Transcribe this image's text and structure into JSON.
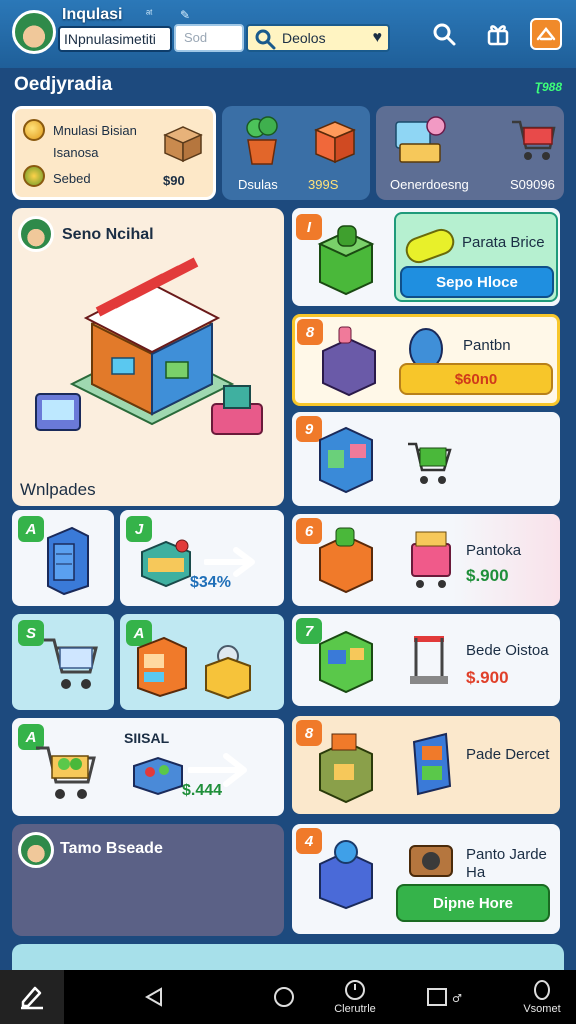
{
  "header": {
    "player_name": "Inqulasi",
    "player_stat": "ᵃᵗ",
    "player_stat_icon": "✎",
    "dropdown_value": "INpnulasimetiti",
    "search_placeholder": "Sod",
    "search_query": "Deolos"
  },
  "section": {
    "title": "Oedjyradia",
    "badge": "Ʈ988"
  },
  "top_cards": [
    {
      "line1": "Mnulasi Bisian",
      "line2": "Isanosa",
      "line3": "Sebed",
      "price": "$90"
    },
    {
      "label": "Dsulas",
      "value": "399S"
    },
    {
      "label": "Oenerdoesng",
      "value": "S09096"
    }
  ],
  "store_card": {
    "title": "Seno Ncihal",
    "subtitle": "Wnlpades"
  },
  "left_items": [
    {
      "badge": "A",
      "tag": ""
    },
    {
      "badge": "J",
      "tag": "$34%"
    },
    {
      "badge": "S",
      "tag": ""
    },
    {
      "badge": "A",
      "tag": ""
    },
    {
      "badge": "A",
      "tag": "SIISAL"
    },
    {
      "badge": "",
      "tag": "$.444"
    }
  ],
  "bottom_left_card": {
    "title": "Tamo Bseade"
  },
  "right_items": [
    {
      "badge": "I",
      "name": "Parata Brice",
      "button": "Sepo Hloce"
    },
    {
      "badge": "8",
      "name": "Pantbn",
      "price": "$60n0"
    },
    {
      "badge": "9",
      "name": "",
      "price": ""
    },
    {
      "badge": "6",
      "name": "Pantoka",
      "price": "$.900"
    },
    {
      "badge": "7",
      "name": "Bede Oistoa",
      "price": "$.900"
    },
    {
      "badge": "8",
      "name": "Pade Dercet",
      "price": ""
    },
    {
      "badge": "4",
      "name": "Panto Jarde Ha",
      "button": "Dipne Hore"
    }
  ],
  "nav": {
    "item3_label": "Clerutrle",
    "item5_label": "Vsomet"
  },
  "colors": {
    "header_bg": "#2b78b8",
    "page_bg": "#1d4a7e",
    "accent_orange": "#f08a2a",
    "accent_green": "#35b34a",
    "price_red": "#e0402a",
    "button_blue": "#1f8fe0",
    "button_yellow": "#f7c62a"
  }
}
